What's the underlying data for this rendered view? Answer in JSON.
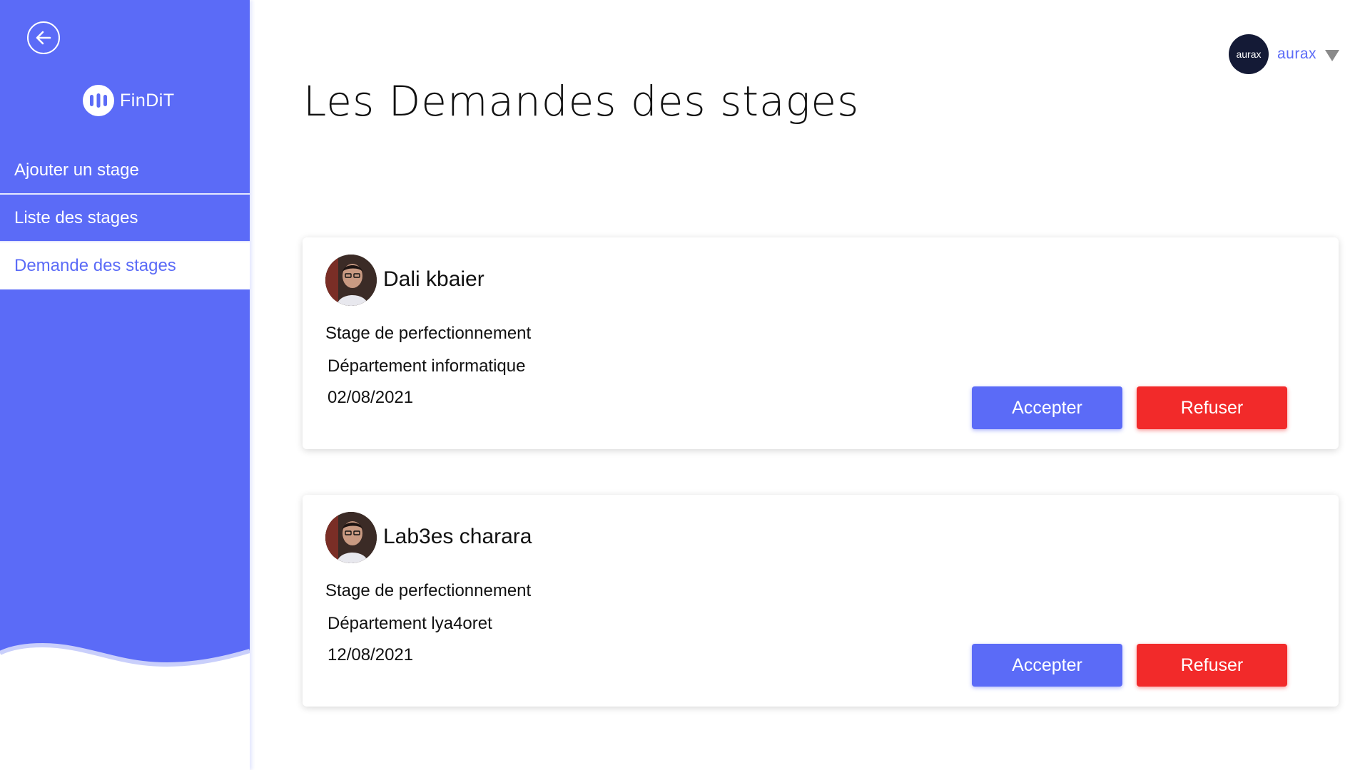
{
  "sidebar": {
    "brand": "FinDiT",
    "items": [
      {
        "label": "Ajouter un stage"
      },
      {
        "label": "Liste des stages"
      },
      {
        "label": "Demande des stages"
      }
    ],
    "accent_color": "#5b6bf7"
  },
  "header": {
    "title": "Les Demandes des stages",
    "user": {
      "avatar_text": "aurax",
      "name": "aurax"
    }
  },
  "requests": [
    {
      "name": "Dali kbaier",
      "type": "Stage de perfectionnement",
      "department": "Département informatique",
      "date": "02/08/2021",
      "accept_label": "Accepter",
      "refuse_label": "Refuser"
    },
    {
      "name": "Lab3es charara",
      "type": "Stage de perfectionnement",
      "department": "Département lya4oret",
      "date": "12/08/2021",
      "accept_label": "Accepter",
      "refuse_label": "Refuser"
    }
  ],
  "colors": {
    "accept": "#5b6bf7",
    "refuse": "#f22a2a"
  }
}
